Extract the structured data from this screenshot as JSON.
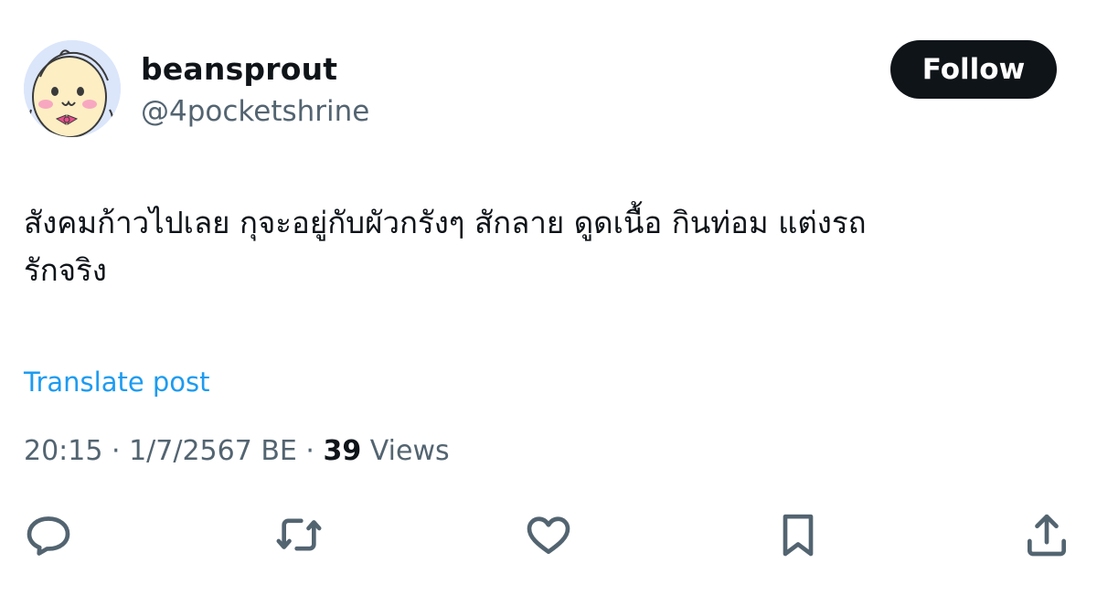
{
  "user": {
    "display_name": "beansprout",
    "handle": "@4pocketshrine",
    "avatar_icon": "cartoon-bean-avatar"
  },
  "follow_label": "Follow",
  "tweet": {
    "line1": "สังคมก้าวไปเลย กุจะอยู่กับผัวกรังๆ สักลาย ดูดเนื้อ กินท่อม แต่งรถ",
    "line2": "รักจริง",
    "translate_label": "Translate post"
  },
  "meta": {
    "time": "20:15",
    "sep1": " · ",
    "date": "1/7/2567 BE",
    "sep2": " · ",
    "views_count": "39",
    "views_label": " Views"
  },
  "actions": [
    "reply-icon",
    "repost-icon",
    "like-icon",
    "bookmark-icon",
    "share-icon"
  ],
  "colors": {
    "accent": "#1d9bf0",
    "text": "#0f1419",
    "secondary": "#536471",
    "button_bg": "#0f1419"
  }
}
